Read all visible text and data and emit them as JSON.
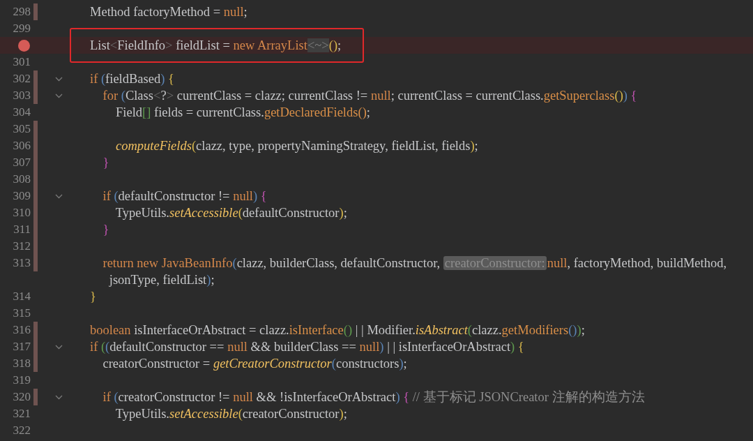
{
  "lines": [
    {
      "number": "298",
      "changed": true,
      "foldable": false,
      "tokens": [
        {
          "kind": "plain",
          "text": "Method factoryMethod = "
        },
        {
          "kind": "keyword",
          "text": "null"
        },
        {
          "kind": "plain",
          "text": ";"
        }
      ]
    },
    {
      "number": "299",
      "changed": false,
      "foldable": false
    },
    {
      "breakpoint": true,
      "highlighted": true,
      "changed": false,
      "foldable": false,
      "tokens": [
        {
          "kind": "plain",
          "text": "List"
        },
        {
          "kind": "dim",
          "text": "<"
        },
        {
          "kind": "plain",
          "text": "FieldInfo"
        },
        {
          "kind": "dim",
          "text": ">"
        },
        {
          "kind": "plain",
          "text": " fieldList = "
        },
        {
          "kind": "keyword",
          "text": "new ArrayList"
        },
        {
          "kind": "folded",
          "text": "<~>"
        },
        {
          "kind": "paren-yellow",
          "text": "()"
        },
        {
          "kind": "plain",
          "text": ";"
        }
      ]
    },
    {
      "number": "301",
      "changed": false,
      "foldable": false
    },
    {
      "number": "302",
      "changed": true,
      "foldable": true,
      "tokens": [
        {
          "kind": "keyword",
          "text": "if "
        },
        {
          "kind": "paren-blue",
          "text": "("
        },
        {
          "kind": "plain",
          "text": "fieldBased"
        },
        {
          "kind": "paren-blue",
          "text": ")"
        },
        {
          "kind": "paren-yellow",
          "text": " {"
        }
      ]
    },
    {
      "number": "303",
      "changed": true,
      "foldable": true,
      "tokens": [
        {
          "kind": "keyword",
          "text": "    for "
        },
        {
          "kind": "paren-blue",
          "text": "("
        },
        {
          "kind": "plain",
          "text": "Class"
        },
        {
          "kind": "dim",
          "text": "<"
        },
        {
          "kind": "plain",
          "text": "?"
        },
        {
          "kind": "dim",
          "text": ">"
        },
        {
          "kind": "plain",
          "text": " currentClass = clazz; currentClass != "
        },
        {
          "kind": "keyword",
          "text": "null"
        },
        {
          "kind": "plain",
          "text": "; currentClass = currentClass."
        },
        {
          "kind": "call",
          "text": "getSuperclass"
        },
        {
          "kind": "paren-yellow",
          "text": "()"
        },
        {
          "kind": "paren-blue",
          "text": ")"
        },
        {
          "kind": "paren-pink",
          "text": " {"
        }
      ]
    },
    {
      "number": "304",
      "changed": false,
      "foldable": false,
      "tokens": [
        {
          "kind": "plain",
          "text": "        Field"
        },
        {
          "kind": "paren-green",
          "text": "[]"
        },
        {
          "kind": "plain",
          "text": " fields = currentClass."
        },
        {
          "kind": "call",
          "text": "getDeclaredFields"
        },
        {
          "kind": "call",
          "text": "()"
        },
        {
          "kind": "plain",
          "text": ";"
        }
      ]
    },
    {
      "number": "305",
      "changed": true,
      "foldable": false
    },
    {
      "number": "306",
      "changed": true,
      "foldable": false,
      "tokens": [
        {
          "kind": "static",
          "text": "        computeFields"
        },
        {
          "kind": "paren-yellow",
          "text": "("
        },
        {
          "kind": "plain",
          "text": "clazz, type, propertyNamingStrategy, fieldList, fields"
        },
        {
          "kind": "paren-yellow",
          "text": ")"
        },
        {
          "kind": "plain",
          "text": ";"
        }
      ]
    },
    {
      "number": "307",
      "changed": true,
      "foldable": false,
      "tokens": [
        {
          "kind": "paren-pink",
          "text": "    }"
        }
      ]
    },
    {
      "number": "308",
      "changed": true,
      "foldable": false
    },
    {
      "number": "309",
      "changed": true,
      "foldable": true,
      "tokens": [
        {
          "kind": "keyword",
          "text": "    if "
        },
        {
          "kind": "paren-blue",
          "text": "("
        },
        {
          "kind": "plain",
          "text": "defaultConstructor != "
        },
        {
          "kind": "keyword",
          "text": "null"
        },
        {
          "kind": "paren-blue",
          "text": ")"
        },
        {
          "kind": "paren-pink",
          "text": " {"
        }
      ]
    },
    {
      "number": "310",
      "changed": true,
      "foldable": false,
      "tokens": [
        {
          "kind": "plain",
          "text": "        TypeUtils."
        },
        {
          "kind": "static",
          "text": "setAccessible"
        },
        {
          "kind": "paren-yellow",
          "text": "("
        },
        {
          "kind": "plain",
          "text": "defaultConstructor"
        },
        {
          "kind": "paren-yellow",
          "text": ")"
        },
        {
          "kind": "plain",
          "text": ";"
        }
      ]
    },
    {
      "number": "311",
      "changed": true,
      "foldable": false,
      "tokens": [
        {
          "kind": "paren-pink",
          "text": "    }"
        }
      ]
    },
    {
      "number": "312",
      "changed": true,
      "foldable": false
    },
    {
      "number": "313",
      "changed": true,
      "foldable": false,
      "tokens": [
        {
          "kind": "keyword",
          "text": "    return new JavaBeanInfo"
        },
        {
          "kind": "paren-blue",
          "text": "("
        },
        {
          "kind": "plain",
          "text": "clazz, builderClass, defaultConstructor, "
        },
        {
          "kind": "hint",
          "text": "creatorConstructor:"
        },
        {
          "kind": "keyword",
          "text": "null"
        },
        {
          "kind": "plain",
          "text": ", factoryMethod, buildMethod,"
        }
      ]
    },
    {
      "changed": false,
      "foldable": false,
      "tokens": [
        {
          "kind": "plain",
          "text": "      jsonType, fieldList"
        },
        {
          "kind": "paren-blue",
          "text": ")"
        },
        {
          "kind": "plain",
          "text": ";"
        }
      ]
    },
    {
      "number": "314",
      "changed": false,
      "foldable": false,
      "tokens": [
        {
          "kind": "paren-yellow",
          "text": "}"
        }
      ]
    },
    {
      "number": "315",
      "changed": false,
      "foldable": false
    },
    {
      "number": "316",
      "changed": true,
      "foldable": false,
      "tokens": [
        {
          "kind": "keyword",
          "text": "boolean"
        },
        {
          "kind": "plain",
          "text": " isInterfaceOrAbstract = clazz."
        },
        {
          "kind": "call",
          "text": "isInterface"
        },
        {
          "kind": "paren-green",
          "text": "()"
        },
        {
          "kind": "plain",
          "text": " | | Modifier."
        },
        {
          "kind": "static",
          "text": "isAbstract"
        },
        {
          "kind": "paren-green",
          "text": "("
        },
        {
          "kind": "plain",
          "text": "clazz."
        },
        {
          "kind": "call",
          "text": "getModifiers"
        },
        {
          "kind": "paren-blue",
          "text": "()"
        },
        {
          "kind": "paren-green",
          "text": ")"
        },
        {
          "kind": "plain",
          "text": ";"
        }
      ]
    },
    {
      "number": "317",
      "changed": true,
      "foldable": true,
      "tokens": [
        {
          "kind": "keyword",
          "text": "if "
        },
        {
          "kind": "paren-green",
          "text": "("
        },
        {
          "kind": "paren-blue",
          "text": "("
        },
        {
          "kind": "plain",
          "text": "defaultConstructor == "
        },
        {
          "kind": "keyword",
          "text": "null"
        },
        {
          "kind": "plain",
          "text": " && builderClass == "
        },
        {
          "kind": "keyword",
          "text": "null"
        },
        {
          "kind": "paren-blue",
          "text": ")"
        },
        {
          "kind": "plain",
          "text": " | | isInterfaceOrAbstract"
        },
        {
          "kind": "paren-green",
          "text": ")"
        },
        {
          "kind": "paren-yellow",
          "text": " {"
        }
      ]
    },
    {
      "number": "318",
      "changed": true,
      "foldable": false,
      "tokens": [
        {
          "kind": "plain",
          "text": "    creatorConstructor = "
        },
        {
          "kind": "static",
          "text": "getCreatorConstructor"
        },
        {
          "kind": "paren-blue",
          "text": "("
        },
        {
          "kind": "plain",
          "text": "constructors"
        },
        {
          "kind": "paren-blue",
          "text": ")"
        },
        {
          "kind": "plain",
          "text": ";"
        }
      ]
    },
    {
      "number": "319",
      "changed": false,
      "foldable": false
    },
    {
      "number": "320",
      "changed": true,
      "foldable": true,
      "tokens": [
        {
          "kind": "keyword",
          "text": "    if "
        },
        {
          "kind": "paren-blue",
          "text": "("
        },
        {
          "kind": "plain",
          "text": "creatorConstructor != "
        },
        {
          "kind": "keyword",
          "text": "null"
        },
        {
          "kind": "plain",
          "text": " && !isInterfaceOrAbstract"
        },
        {
          "kind": "paren-blue",
          "text": ")"
        },
        {
          "kind": "paren-pink",
          "text": " {"
        },
        {
          "kind": "comment",
          "text": " // 基于标记 JSONCreator 注解的构造方法"
        }
      ]
    },
    {
      "number": "321",
      "changed": false,
      "foldable": false,
      "tokens": [
        {
          "kind": "plain",
          "text": "        TypeUtils."
        },
        {
          "kind": "static",
          "text": "setAccessible"
        },
        {
          "kind": "paren-yellow",
          "text": "("
        },
        {
          "kind": "plain",
          "text": "creatorConstructor"
        },
        {
          "kind": "paren-yellow",
          "text": ")"
        },
        {
          "kind": "plain",
          "text": ";"
        }
      ]
    },
    {
      "number": "322",
      "changed": false,
      "foldable": false
    }
  ]
}
